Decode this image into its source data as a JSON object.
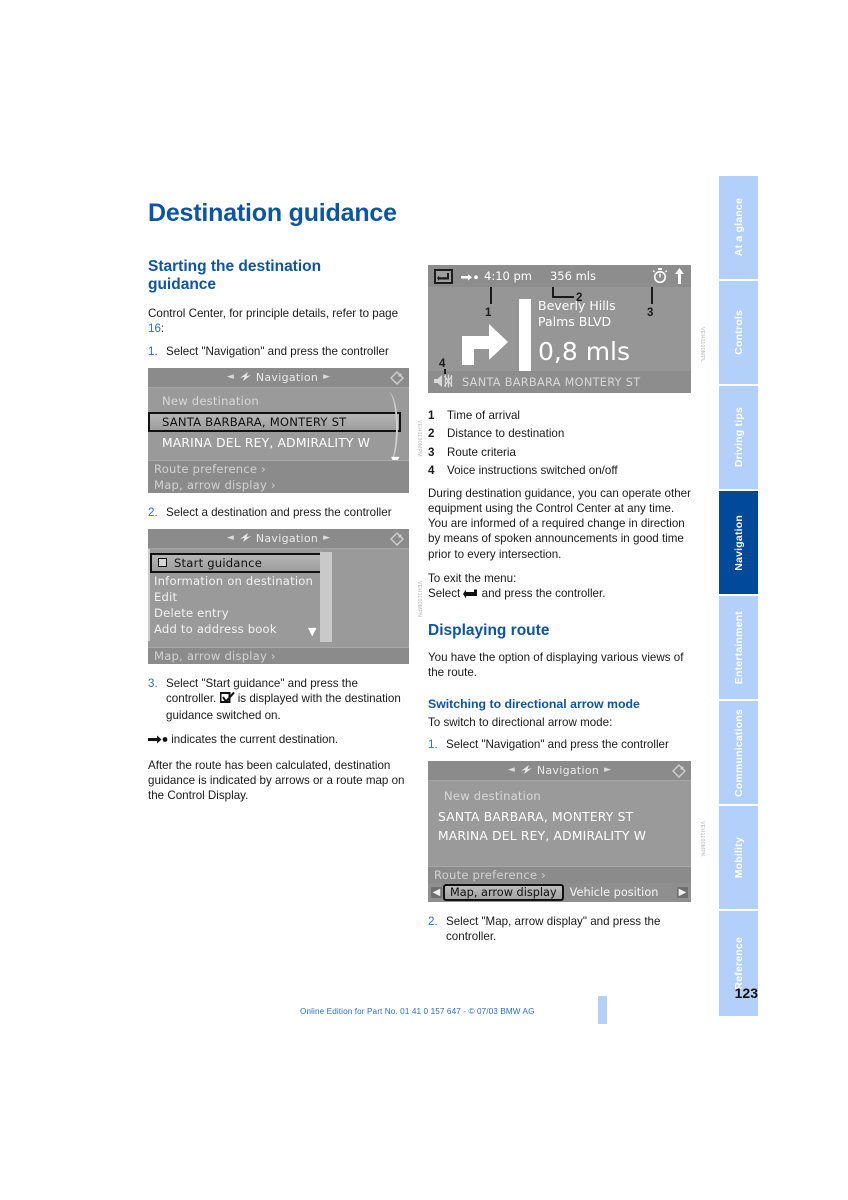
{
  "page": {
    "title": "Destination guidance",
    "number": "123",
    "footer_note": "Online Edition for Part No. 01 41 0 157 647 - © 07/03 BMW AG"
  },
  "sidebar": {
    "tabs": [
      {
        "label": "At a glance",
        "active": false
      },
      {
        "label": "Controls",
        "active": false
      },
      {
        "label": "Driving tips",
        "active": false
      },
      {
        "label": "Navigation",
        "active": true
      },
      {
        "label": "Entertainment",
        "active": false
      },
      {
        "label": "Communications",
        "active": false
      },
      {
        "label": "Mobility",
        "active": false
      },
      {
        "label": "Reference",
        "active": false
      }
    ],
    "colors": {
      "inactive_bg": "#b3d0fa",
      "active_bg": "#004a99",
      "text": "#ffffff"
    }
  },
  "left_column": {
    "section_heading": "Starting the destination guidance",
    "intro": "Control Center, for principle details, refer to page ",
    "intro_pageref": "16",
    "intro_tail": ":",
    "step1": {
      "num": "1.",
      "text": "Select \"Navigation\" and press the controller"
    },
    "screen1": {
      "header_title": "Navigation",
      "rows": [
        {
          "label": "New destination",
          "style": "dim"
        },
        {
          "label": "SANTA BARBARA, MONTERY ST",
          "style": "selected"
        },
        {
          "label": "MARINA DEL REY, ADMIRALITY W",
          "style": "big"
        }
      ],
      "footer_rows": [
        {
          "label": "Route preference  ›"
        },
        {
          "label": "Map, arrow display  ›"
        }
      ],
      "figcode": "VEH1100MPM"
    },
    "step2": {
      "num": "2.",
      "text": "Select a destination and press the controller"
    },
    "screen2": {
      "header_title": "Navigation",
      "rows": [
        {
          "label": "Start guidance",
          "style": "selected",
          "checkbox": true
        },
        {
          "label": "Information on destination",
          "style": "plain"
        },
        {
          "label": "Edit",
          "style": "plain"
        },
        {
          "label": "Delete entry",
          "style": "plain"
        },
        {
          "label": "Add to address book",
          "style": "plain"
        }
      ],
      "footer_rows": [
        {
          "label": "Map, arrow display  ›"
        }
      ],
      "figcode": "VEH1100MPN"
    },
    "step3": {
      "num": "3.",
      "text_a": "Select \"Start guidance\" and press the controller. ",
      "icon": "checkbox-checked-icon",
      "text_b": " is displayed with the destination guidance switched on."
    },
    "dest_note": {
      "icon": "arrow-dot-icon",
      "text": " indicates the current destination."
    },
    "after_note": "After the route has been calculated, destination guidance is indicated by arrows or a route map on the Control Display."
  },
  "right_column": {
    "nav_display": {
      "back_icon": "back-arrow-icon",
      "destination_icon": "arrow-dot-icon",
      "time_of_arrival": "4:10 pm",
      "distance_to_destination": "356  mls",
      "route_criteria_icon": "stopwatch-icon",
      "compass_icon": "north-arrow-icon",
      "city_line1": "Beverly Hills",
      "city_line2": "Palms BLVD",
      "next_turn_distance": "0,8 mls",
      "turn_icon": "turn-right-icon",
      "voice_icon": "speaker-muted-icon",
      "current_street": "SANTA BARBARA MONTERY ST",
      "callouts": [
        "1",
        "2",
        "3",
        "4"
      ],
      "figcode": "VEH1100MPL"
    },
    "legend": [
      {
        "num": "1",
        "text": "Time of arrival"
      },
      {
        "num": "2",
        "text": "Distance to destination"
      },
      {
        "num": "3",
        "text": "Route criteria"
      },
      {
        "num": "4",
        "text": "Voice instructions switched on/off"
      }
    ],
    "paragraph1": "During destination guidance, you can operate other equipment using the Control Center at any time. You are informed of a required change in direction by means of spoken announcements in good time prior to every intersection.",
    "exit_label": "To exit the menu:",
    "exit_text_a": "Select ",
    "exit_icon": "back-arrow-icon",
    "exit_text_b": " and press the controller.",
    "heading_displaying_route": "Displaying route",
    "paragraph2": "You have the option of displaying various views of the route.",
    "subheading_arrow_mode": "Switching to directional arrow mode",
    "paragraph3": "To switch to directional arrow mode:",
    "step1": {
      "num": "1.",
      "text": "Select \"Navigation\" and press the controller"
    },
    "screen3": {
      "header_title": "Navigation",
      "rows": [
        {
          "label": "New destination",
          "style": "dim"
        },
        {
          "label": "SANTA BARBARA, MONTERY ST",
          "style": "big"
        },
        {
          "label": "MARINA DEL REY, ADMIRALITY W",
          "style": "big"
        }
      ],
      "footer_row": "Route preference  ›",
      "tabstrip": {
        "left_arrow": "◀",
        "selected_tab": "Map, arrow display",
        "other_tab": "Vehicle position",
        "right_arrow": "▶"
      },
      "figcode": "VEH1100MPK"
    },
    "step2": {
      "num": "2.",
      "text": "Select \"Map, arrow display\" and press the controller."
    }
  }
}
